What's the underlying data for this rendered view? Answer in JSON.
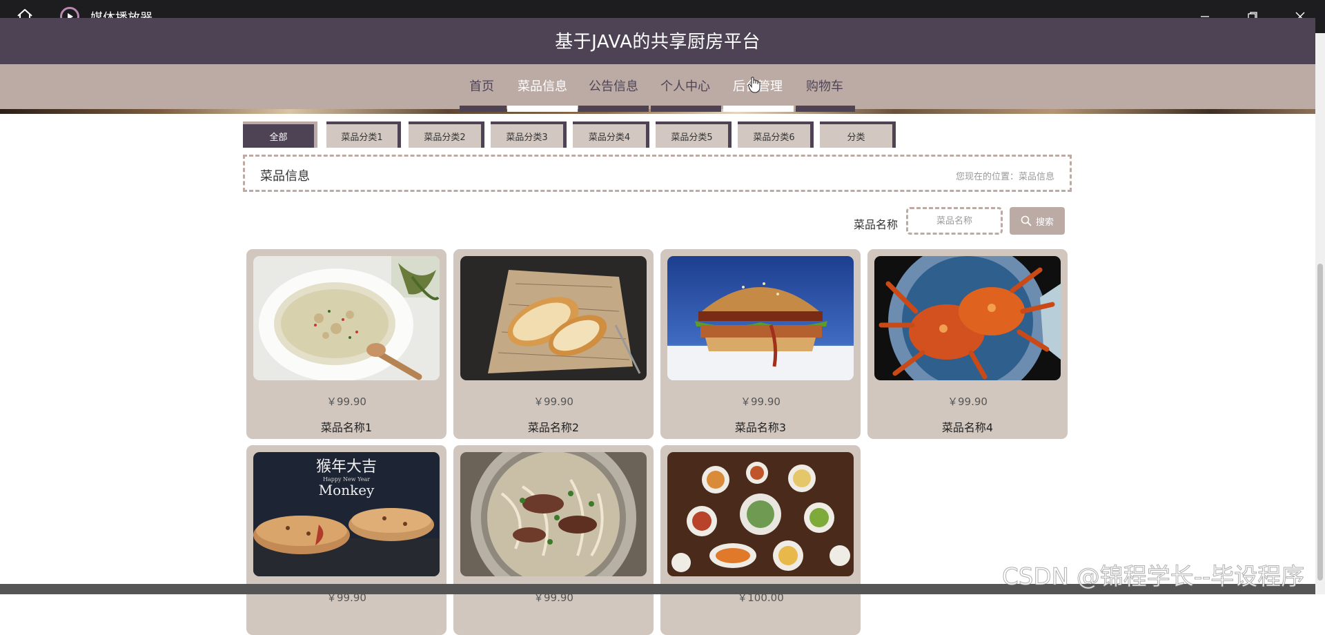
{
  "window": {
    "title": "媒体播放器",
    "icons": {
      "home": "home-icon",
      "app": "play-icon",
      "minimize": "minimize-icon",
      "restore": "restore-icon",
      "close": "close-icon"
    }
  },
  "site": {
    "title": "基于JAVA的共享厨房平台"
  },
  "nav": {
    "items": [
      {
        "label": "首页",
        "active": false
      },
      {
        "label": "菜品信息",
        "active": true
      },
      {
        "label": "公告信息",
        "active": false
      },
      {
        "label": "个人中心",
        "active": false
      },
      {
        "label": "后台管理",
        "active": true
      },
      {
        "label": "购物车",
        "active": false
      }
    ]
  },
  "categories": [
    {
      "label": "全部",
      "active": true
    },
    {
      "label": "菜品分类1",
      "active": false
    },
    {
      "label": "菜品分类2",
      "active": false
    },
    {
      "label": "菜品分类3",
      "active": false
    },
    {
      "label": "菜品分类4",
      "active": false
    },
    {
      "label": "菜品分类5",
      "active": false
    },
    {
      "label": "菜品分类6",
      "active": false
    },
    {
      "label": "分类",
      "active": false
    }
  ],
  "breadcrumb": {
    "title": "菜品信息",
    "location": "您现在的位置：菜品信息"
  },
  "search": {
    "label": "菜品名称",
    "placeholder": "菜品名称",
    "button": "搜索"
  },
  "products": [
    {
      "price": "￥99.90",
      "name": "菜品名称1",
      "image": "soup"
    },
    {
      "price": "￥99.90",
      "name": "菜品名称2",
      "image": "bread"
    },
    {
      "price": "￥99.90",
      "name": "菜品名称3",
      "image": "burger"
    },
    {
      "price": "￥99.90",
      "name": "菜品名称4",
      "image": "crabs"
    },
    {
      "price": "￥99.90",
      "name": "",
      "image": "cookies"
    },
    {
      "price": "￥99.90",
      "name": "",
      "image": "noodles"
    },
    {
      "price": "￥100.00",
      "name": "",
      "image": "banquet"
    }
  ],
  "image_text": {
    "cookies_banner": "猴年大吉",
    "cookies_sub": "Happy New Year",
    "cookies_brand": "Monkey"
  },
  "watermark": "CSDN @锦程学长--毕设程序",
  "colors": {
    "header": "#4d4354",
    "nav": "#bcaba5",
    "card": "#d2c7bf"
  }
}
